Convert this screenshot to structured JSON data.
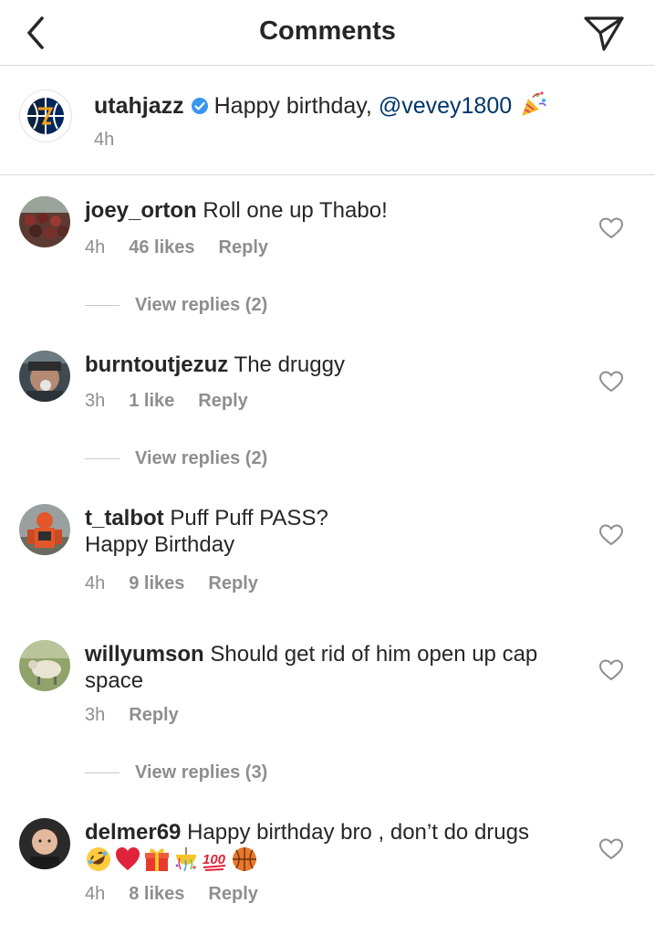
{
  "header": {
    "title": "Comments"
  },
  "caption": {
    "username": "utahjazz",
    "text": "Happy birthday,",
    "mention": "@vevey1800",
    "time": "4h"
  },
  "comments": [
    {
      "username": "joey_orton",
      "text": "Roll one up Thabo!",
      "time": "4h",
      "likes": "46 likes",
      "reply": "Reply",
      "view_replies": "View replies (2)"
    },
    {
      "username": "burntoutjezuz",
      "text": "The druggy",
      "time": "3h",
      "likes": "1 like",
      "reply": "Reply",
      "view_replies": "View replies (2)"
    },
    {
      "username": "t_talbot",
      "text": "Puff Puff PASS?",
      "text_line2": "Happy Birthday",
      "time": "4h",
      "likes": "9 likes",
      "reply": "Reply"
    },
    {
      "username": "willyumson",
      "text": "Should get rid of him open up cap space",
      "time": "3h",
      "reply": "Reply",
      "view_replies": "View replies (3)"
    },
    {
      "username": "delmer69",
      "text": "Happy birthday bro , don’t do drugs",
      "emoji_line": [
        "rofl-emoji",
        "red-heart-emoji",
        "gift-emoji",
        "confetti-ball-emoji",
        "hundred-points-emoji",
        "basketball-emoji"
      ],
      "emoji_100": "100",
      "time": "4h",
      "likes": "8 likes",
      "reply": "Reply"
    }
  ],
  "icons": {
    "back": "chevron-left-icon",
    "send": "paper-plane-icon",
    "verified": "verified-badge-icon",
    "party": "party-popper-icon",
    "like": "heart-outline-icon"
  },
  "colors": {
    "text": "#262626",
    "muted": "#8e8e8e",
    "mention": "#003569",
    "verified": "#3897f0",
    "divider": "#dbdbdb"
  }
}
